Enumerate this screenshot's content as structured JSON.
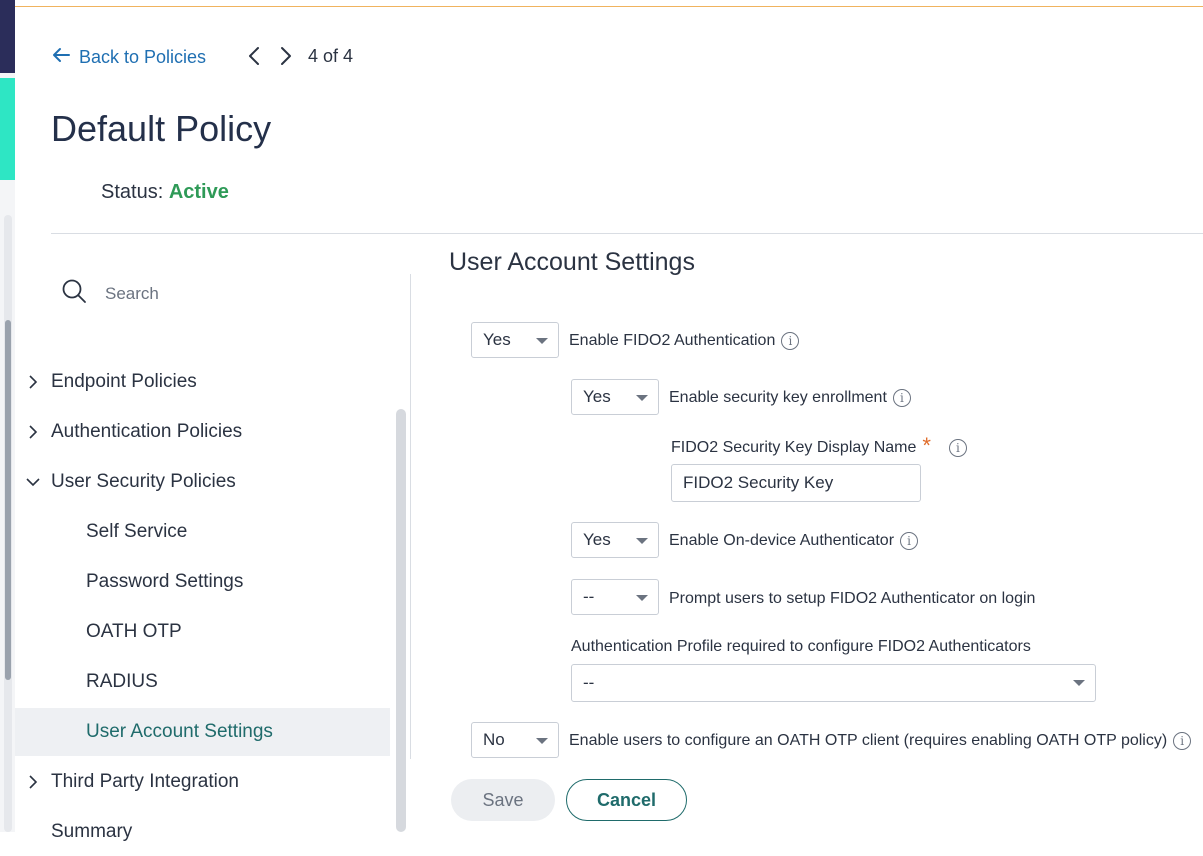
{
  "header": {
    "back_label": "Back to Policies",
    "pager_count": "4 of 4",
    "title": "Default Policy",
    "status_label": "Status:",
    "status_value": "Active"
  },
  "sidebar": {
    "search_placeholder": "Search",
    "items": [
      {
        "label": "Endpoint Policies",
        "expanded": false
      },
      {
        "label": "Authentication Policies",
        "expanded": false
      },
      {
        "label": "User Security Policies",
        "expanded": true
      },
      {
        "label": "Self Service"
      },
      {
        "label": "Password Settings"
      },
      {
        "label": "OATH OTP"
      },
      {
        "label": "RADIUS"
      },
      {
        "label": "User Account Settings",
        "active": true
      },
      {
        "label": "Third Party Integration",
        "expanded": false
      },
      {
        "label": "Summary"
      }
    ]
  },
  "main": {
    "section_title": "User Account Settings",
    "fido2": {
      "value": "Yes",
      "label": "Enable FIDO2 Authentication"
    },
    "security_key": {
      "value": "Yes",
      "label": "Enable security key enrollment"
    },
    "display_name": {
      "label": "FIDO2 Security Key Display Name",
      "required_mark": "*",
      "value": "FIDO2 Security Key"
    },
    "on_device": {
      "value": "Yes",
      "label": "Enable On-device Authenticator"
    },
    "prompt_setup": {
      "value": "--",
      "label": "Prompt users to setup FIDO2 Authenticator on login"
    },
    "auth_profile": {
      "label": "Authentication Profile required to configure FIDO2 Authenticators",
      "value": "--"
    },
    "oath_client": {
      "value": "No",
      "label": "Enable users to configure an OATH OTP client (requires enabling OATH OTP policy)"
    },
    "save_label": "Save",
    "cancel_label": "Cancel"
  },
  "colors": {
    "link": "#1f6fb2",
    "status_active": "#2e9a57",
    "accent_teal": "#1f6b6b",
    "required": "#e06c2a",
    "top_rule": "#f0b35e"
  }
}
